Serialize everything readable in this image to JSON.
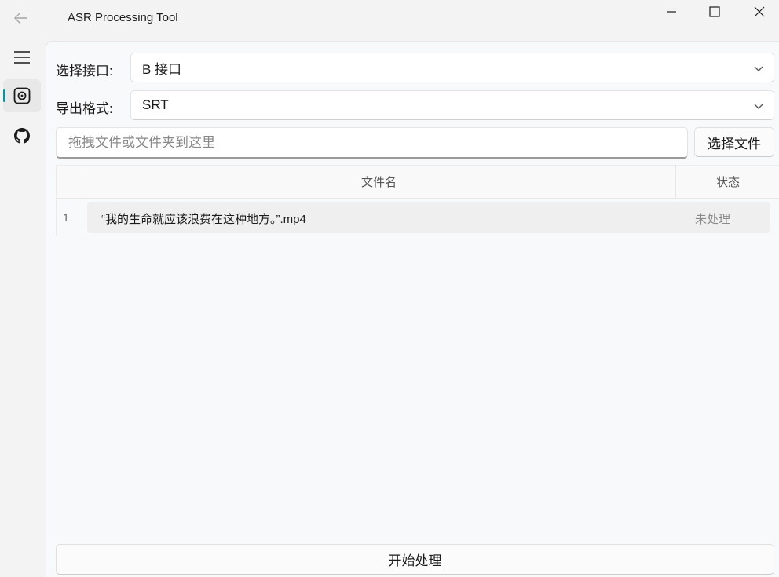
{
  "window": {
    "title": "ASR Processing Tool",
    "back_icon": "arrow-left-icon",
    "minimize_icon": "minimize-icon",
    "maximize_icon": "maximize-icon",
    "close_icon": "close-icon"
  },
  "nav": {
    "items": [
      {
        "icon": "hamburger-menu-icon"
      },
      {
        "icon": "asr-home-icon",
        "selected": true
      },
      {
        "icon": "github-icon"
      }
    ],
    "accent_color": "#0f8e9c"
  },
  "form": {
    "api_label": "选择接口:",
    "api_value": "B 接口",
    "format_label": "导出格式:",
    "format_value": "SRT",
    "drop_placeholder": "拖拽文件或文件夹到这里",
    "select_file_label": "选择文件"
  },
  "table": {
    "headers": {
      "name": "文件名",
      "status": "状态"
    },
    "rows": [
      {
        "index": "1",
        "name": "“我的生命就应该浪费在这种地方。”.mp4",
        "status": "未处理"
      }
    ]
  },
  "actions": {
    "start_label": "开始处理"
  }
}
